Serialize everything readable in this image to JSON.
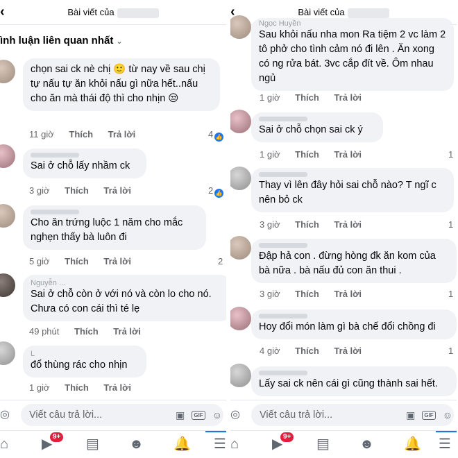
{
  "left": {
    "header": {
      "title": "Bài viết của"
    },
    "section_title": "ình luận liên quan nhất",
    "comments": [
      {
        "text": "chọn sai ck nè chị 🙂 từ nay về sau chị tự nấu tự ăn khỏi nấu gì nữa hết..nấu cho ăn mà thái độ thì cho nhịn 😒",
        "time": "11 giờ",
        "like": "Thích",
        "reply": "Trả lời",
        "reactions": "4"
      },
      {
        "text": "Sai ở chỗ lấy nhầm ck",
        "time": "3 giờ",
        "like": "Thích",
        "reply": "Trả lời",
        "reactions": "2"
      },
      {
        "text": "Cho ăn trứng luộc 1 năm cho mắc nghẹn thấy bà luôn đi",
        "time": "5 giờ",
        "like": "Thích",
        "reply": "Trả lời",
        "reactions": "2"
      },
      {
        "name": "Nguyễn ...",
        "text": "Sai ở chỗ còn ở với nó và còn lo cho nó. Chưa có con cái thì té lẹ",
        "time": "49 phút",
        "like": "Thích",
        "reply": "Trả lời",
        "reactions": ""
      },
      {
        "name": "L",
        "text": "đổ thùng rác cho nhịn",
        "time": "1 giờ",
        "like": "Thích",
        "reply": "Trả lời",
        "reactions": ""
      }
    ],
    "reply_placeholder": "Viết câu trả lời...",
    "notif_badge": "9+"
  },
  "right": {
    "header": {
      "title": "Bài viết của"
    },
    "comments": [
      {
        "name": "Ngọc Huyền",
        "text": "Sau khỏi nấu nha mon Ra tiệm 2 vc làm 2 tô phở cho tình cảm nó đi lên . Ăn xong có ng rửa bát. 3vc cắp đít về. Ôm nhau ngủ",
        "time": "1 giờ",
        "like": "Thích",
        "reply": "Trả lời",
        "reactions": ""
      },
      {
        "text": "Sai ở chỗ chọn sai ck ý",
        "time": "1 giờ",
        "like": "Thích",
        "reply": "Trả lời",
        "reactions": "1"
      },
      {
        "text": "Thay vì lên đây hỏi sai chỗ nào? T ngĩ c nên bỏ ck",
        "time": "3 giờ",
        "like": "Thích",
        "reply": "Trả lời",
        "reactions": "1"
      },
      {
        "text": "Đập hả con . đừng hòng đk ăn kom của bà nữa . bà nấu đủ con ăn thui .",
        "time": "3 giờ",
        "like": "Thích",
        "reply": "Trả lời",
        "reactions": "1"
      },
      {
        "text": "Hoy đổi món làm gì bà chế đổi chồng đi",
        "time": "4 giờ",
        "like": "Thích",
        "reply": "Trả lời",
        "reactions": "1"
      },
      {
        "text": "Lấy sai ck nên cái gì cũng thành sai hết.",
        "time": "",
        "like": "",
        "reply": "",
        "reactions": ""
      }
    ],
    "reply_placeholder": "Viết câu trả lời...",
    "notif_badge": "9+"
  },
  "colors": {
    "accent": "#1877f2",
    "bubble": "#f0f2f5",
    "badge": "#e41e3f",
    "meta": "#65676b"
  },
  "icons": [
    "back-icon",
    "chevron-down-icon",
    "camera-icon",
    "sticker-icon",
    "gif-icon",
    "emoji-icon",
    "home-icon",
    "watch-icon",
    "marketplace-icon",
    "groups-icon",
    "bell-icon",
    "menu-icon",
    "like-icon"
  ]
}
